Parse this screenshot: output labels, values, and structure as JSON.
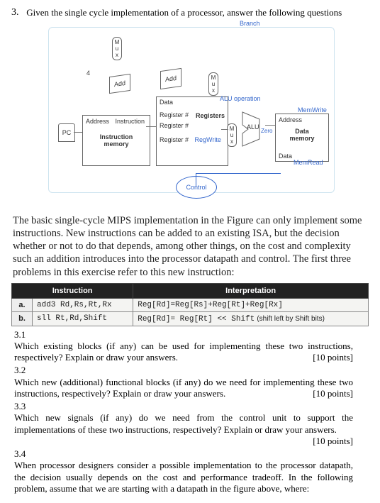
{
  "question": {
    "number": "3.",
    "prompt": "Given the single cycle implementation of a processor, answer the following questions"
  },
  "diagram": {
    "branch": "Branch",
    "mux": "M\nu\nx",
    "four": "4",
    "add1": "Add",
    "add2": "Add",
    "pc": "PC",
    "imem_addr": "Address",
    "imem_instr": "Instruction",
    "imem_label": "Instruction\nmemory",
    "data": "Data",
    "reg_read1": "Register #",
    "reg_title": "Registers",
    "reg_read2": "Register #",
    "reg_write": "Register #",
    "regwrite": "RegWrite",
    "aluop": "ALU operation",
    "alu": "ALU",
    "zero": "Zero",
    "dmem_addr": "Address",
    "dmem_data": "Data",
    "dmem_label": "Data\nmemory",
    "memwrite": "MemWrite",
    "memread": "MemRead",
    "control": "Control"
  },
  "paragraph": "The basic single-cycle MIPS implementation in the Figure can only implement some instructions. New instructions can be added to an existing ISA, but the decision whether or not to do that depends, among other things, on the cost and complexity such an addition introduces into the processor datapath and control. The first three problems in this exercise refer to this new instruction:",
  "table": {
    "h1": "Instruction",
    "h2": "Interpretation",
    "a_label": "a.",
    "a_instr": "add3 Rd,Rs,Rt,Rx",
    "a_interp": "Reg[Rd]=Reg[Rs]+Reg[Rt]+Reg[Rx]",
    "b_label": "b.",
    "b_instr": "sll Rt,Rd,Shift",
    "b_interp_mono": "Reg[Rd]= Reg[Rt] << Shift",
    "b_interp_note": "(shift left by Shift bits)"
  },
  "subs": {
    "q31_num": "3.1",
    "q31": "Which existing blocks (if any) can be used for implementing these two instructions, respectively? Explain or draw your answers.",
    "q31_pts": "[10 points]",
    "q32_num": "3.2",
    "q32": "Which new (additional) functional blocks (if any) do we need for implementing these two instructions, respectively? Explain or draw your answers.",
    "q32_pts": "[10 points]",
    "q33_num": "3.3",
    "q33": "Which new signals (if any) do we need from the control unit to support the implementations of these two instructions, respectively? Explain or draw your answers.",
    "q33_pts": "[10 points]",
    "q34_num": "3.4",
    "q34": "When processor designers consider a possible implementation to the processor datapath, the decision usually depends on the cost and performance tradeoff. In the following problem, assume that we are starting with a datapath in the figure above, where:"
  }
}
